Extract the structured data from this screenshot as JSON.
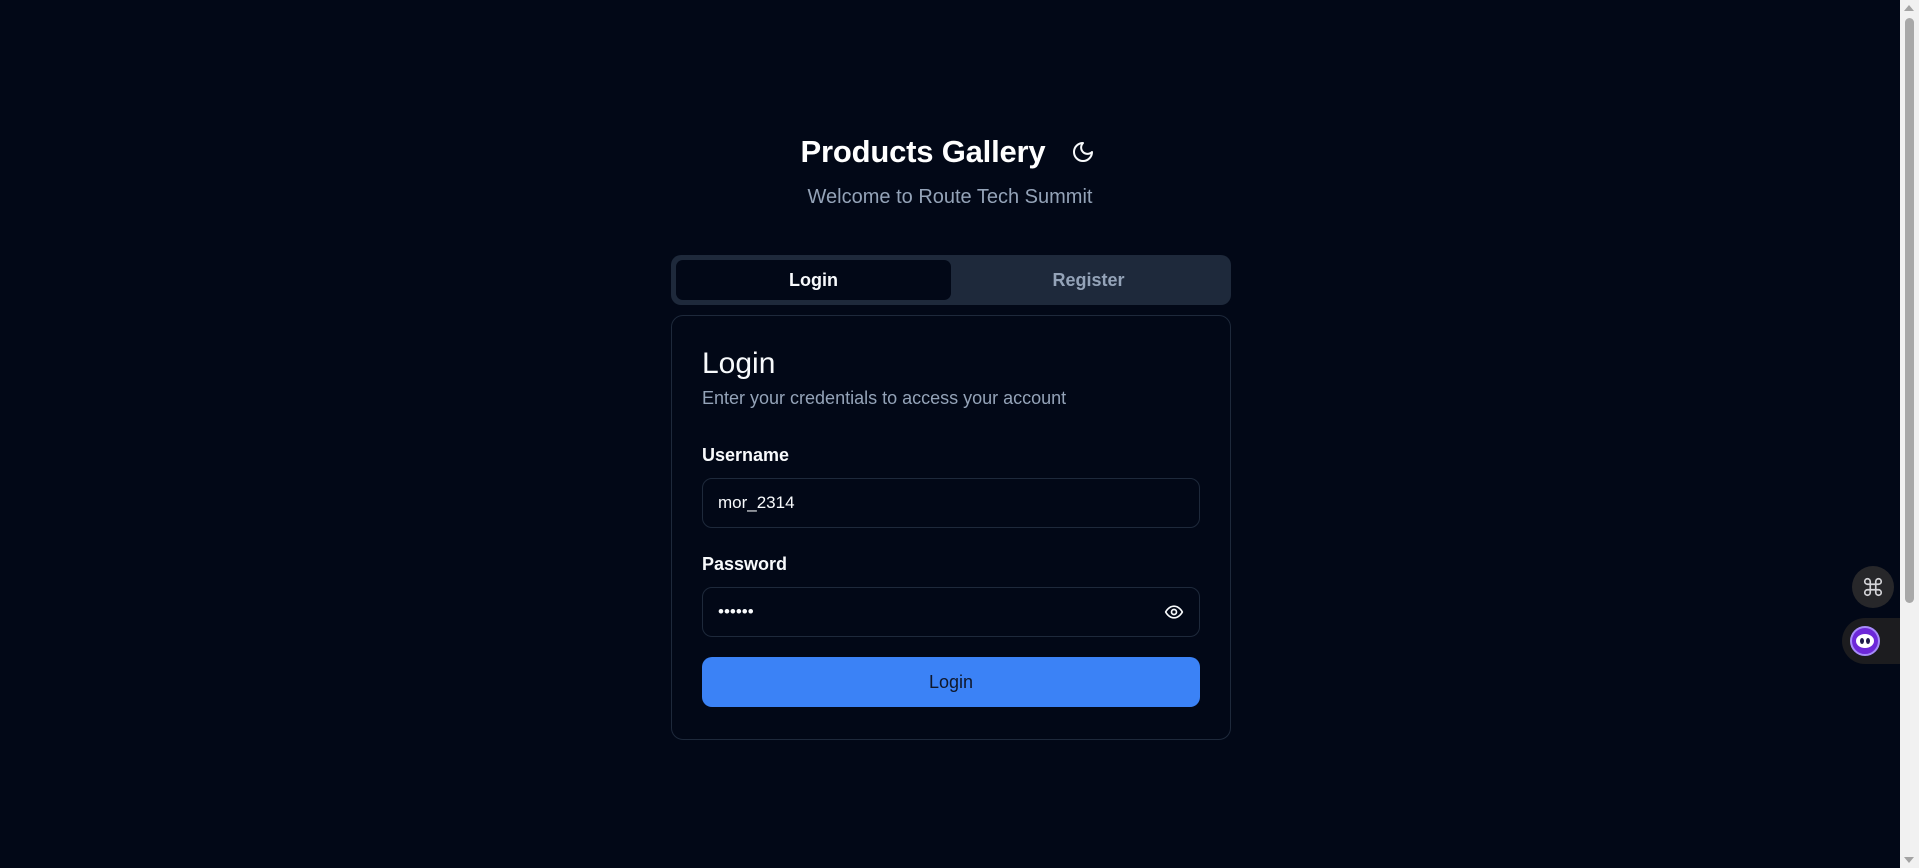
{
  "header": {
    "title": "Products Gallery",
    "subtitle": "Welcome to Route Tech Summit",
    "theme_toggle_icon": "moon-icon"
  },
  "tabs": [
    {
      "label": "Login",
      "active": true
    },
    {
      "label": "Register",
      "active": false
    }
  ],
  "login_card": {
    "title": "Login",
    "description": "Enter your credentials to access your account",
    "username": {
      "label": "Username",
      "value": "mor_2314"
    },
    "password": {
      "label": "Password",
      "value": "••••••",
      "toggle_icon": "eye-icon"
    },
    "submit_label": "Login"
  },
  "floating": {
    "shortcut_icon": "command-icon",
    "assistant_icon": "assistant-face-icon"
  },
  "colors": {
    "background": "#020817",
    "accent": "#3b82f6",
    "muted_text": "#94a3b8",
    "border": "#1e293b"
  }
}
